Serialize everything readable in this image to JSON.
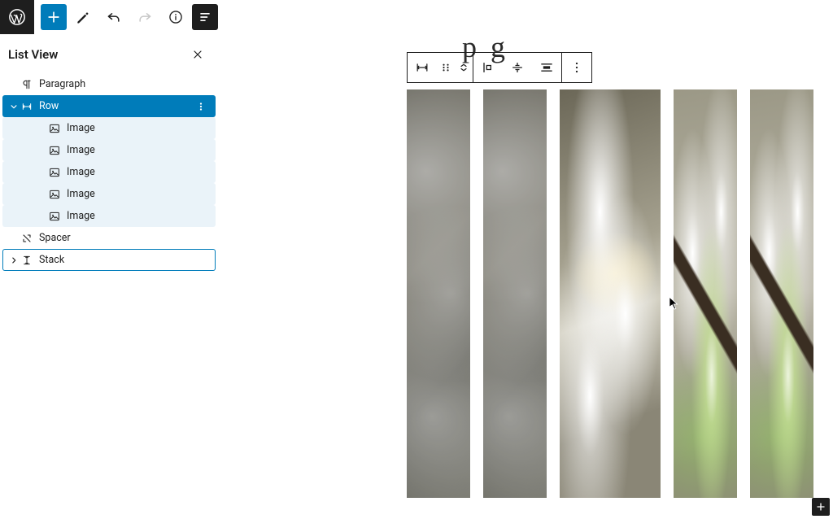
{
  "sidebar": {
    "title": "List View",
    "items": [
      {
        "label": "Paragraph",
        "icon": "paragraph",
        "depth": 1,
        "state": "normal",
        "expander": "none",
        "opts": false
      },
      {
        "label": "Row",
        "icon": "row",
        "depth": 1,
        "state": "selected",
        "expander": "down",
        "opts": true
      },
      {
        "label": "Image",
        "icon": "image",
        "depth": 2,
        "state": "nested",
        "expander": "none",
        "opts": false
      },
      {
        "label": "Image",
        "icon": "image",
        "depth": 2,
        "state": "nested",
        "expander": "none",
        "opts": false
      },
      {
        "label": "Image",
        "icon": "image",
        "depth": 2,
        "state": "nested",
        "expander": "none",
        "opts": false
      },
      {
        "label": "Image",
        "icon": "image",
        "depth": 2,
        "state": "nested",
        "expander": "none",
        "opts": false
      },
      {
        "label": "Image",
        "icon": "image",
        "depth": 2,
        "state": "nested",
        "expander": "none",
        "opts": false
      },
      {
        "label": "Spacer",
        "icon": "spacer",
        "depth": 1,
        "state": "normal",
        "expander": "none",
        "opts": false
      },
      {
        "label": "Stack",
        "icon": "stack",
        "depth": 1,
        "state": "outlined",
        "expander": "right",
        "opts": false
      }
    ]
  },
  "editor_partial_title": "p  g",
  "gallery_count": 5
}
